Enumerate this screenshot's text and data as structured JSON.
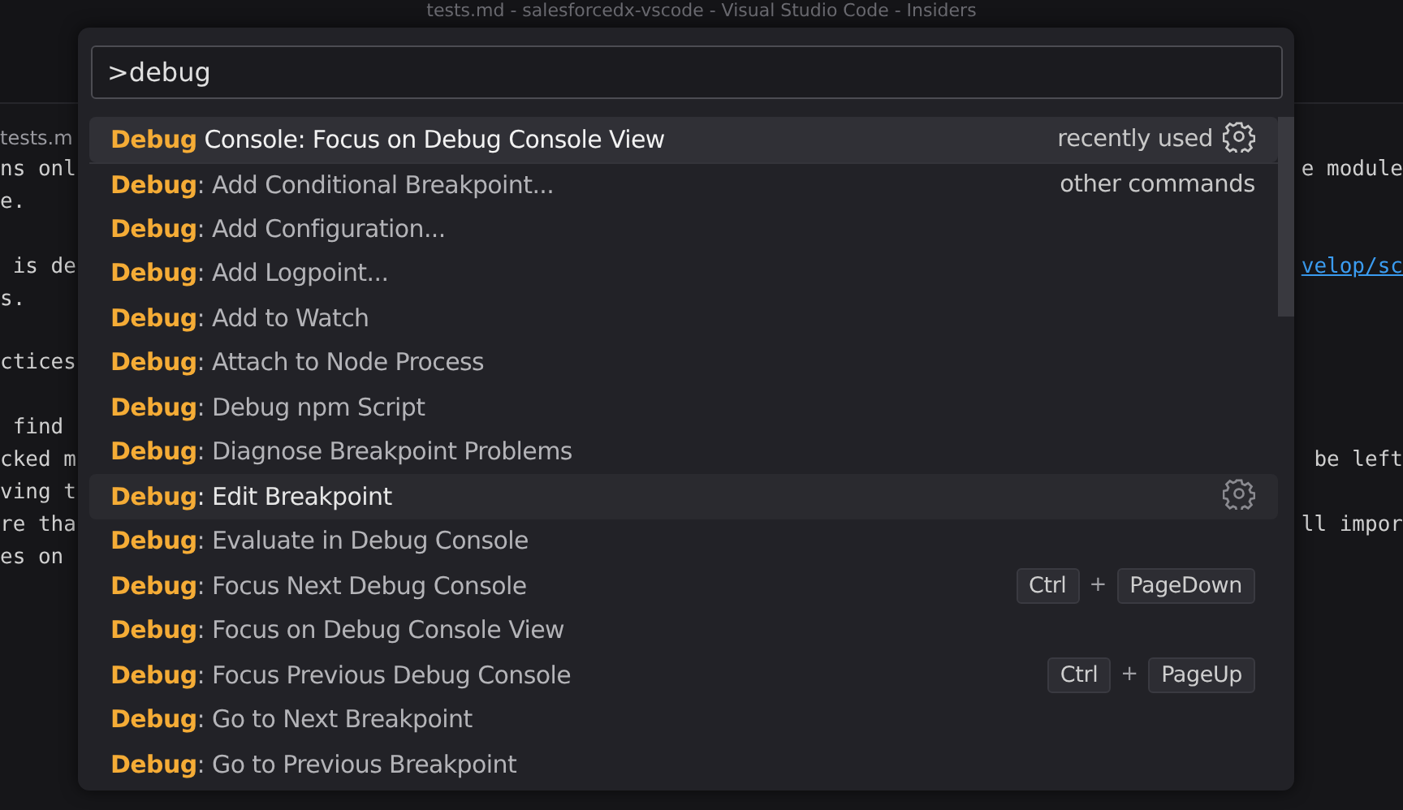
{
  "window": {
    "title": "tests.md - salesforcedx-vscode - Visual Studio Code - Insiders"
  },
  "editor": {
    "breadcrumb": "tests.m",
    "paragraphs": [
      [
        {
          "left": "ns onl",
          "right": "e module"
        },
        {
          "left": "e."
        }
      ],
      [
        {
          "left": " is de",
          "right": "velop/sc",
          "right_is_link": true
        },
        {
          "left": "s."
        }
      ],
      [
        {
          "left": "ctices"
        }
      ],
      [
        {
          "left": " find"
        },
        {
          "left": "cked m",
          "right": "be left"
        },
        {
          "left": "ving t"
        },
        {
          "left": "re tha",
          "right": "ll impor"
        },
        {
          "left": "es on"
        }
      ]
    ]
  },
  "command_palette": {
    "input": {
      "value": ">debug"
    },
    "items": [
      {
        "match": "Debug",
        "rest": " Console: Focus on Debug Console View",
        "selected": true,
        "hovered": false,
        "group_label": "recently used"
      },
      {
        "match": "Debug",
        "rest": ": Add Conditional Breakpoint...",
        "selected": false,
        "hovered": false,
        "group_label": "other commands",
        "separator_above": true
      },
      {
        "match": "Debug",
        "rest": ": Add Configuration...",
        "selected": false,
        "hovered": false
      },
      {
        "match": "Debug",
        "rest": ": Add Logpoint...",
        "selected": false,
        "hovered": false
      },
      {
        "match": "Debug",
        "rest": ": Add to Watch",
        "selected": false,
        "hovered": false
      },
      {
        "match": "Debug",
        "rest": ": Attach to Node Process",
        "selected": false,
        "hovered": false
      },
      {
        "match": "Debug",
        "rest": ": Debug npm Script",
        "selected": false,
        "hovered": false
      },
      {
        "match": "Debug",
        "rest": ": Diagnose Breakpoint Problems",
        "selected": false,
        "hovered": false
      },
      {
        "match": "Debug",
        "rest": ": Edit Breakpoint",
        "selected": false,
        "hovered": true
      },
      {
        "match": "Debug",
        "rest": ": Evaluate in Debug Console",
        "selected": false,
        "hovered": false
      },
      {
        "match": "Debug",
        "rest": ": Focus Next Debug Console",
        "selected": false,
        "hovered": false,
        "keybinding": {
          "keys": [
            "Ctrl",
            "PageDown"
          ],
          "separator": "+"
        }
      },
      {
        "match": "Debug",
        "rest": ": Focus on Debug Console View",
        "selected": false,
        "hovered": false
      },
      {
        "match": "Debug",
        "rest": ": Focus Previous Debug Console",
        "selected": false,
        "hovered": false,
        "keybinding": {
          "keys": [
            "Ctrl",
            "PageUp"
          ],
          "separator": "+"
        }
      },
      {
        "match": "Debug",
        "rest": ": Go to Next Breakpoint",
        "selected": false,
        "hovered": false
      },
      {
        "match": "Debug",
        "rest": ": Go to Previous Breakpoint",
        "selected": false,
        "hovered": false
      }
    ]
  }
}
